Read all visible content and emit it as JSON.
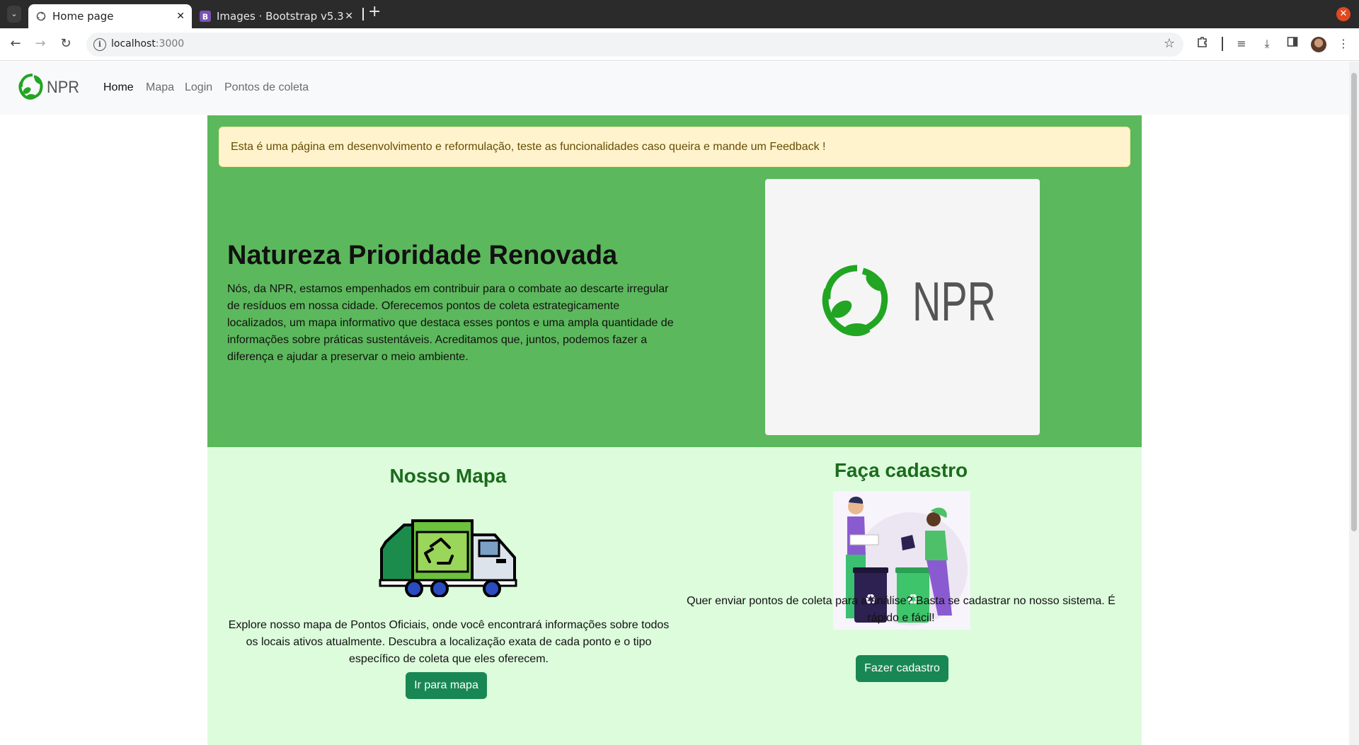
{
  "browser": {
    "tabs": [
      {
        "title": "Home page",
        "active": true,
        "favicon": "recycle-icon"
      },
      {
        "title": "Images · Bootstrap v5.3",
        "active": false,
        "favicon": "bootstrap-icon"
      }
    ],
    "url_host": "localhost",
    "url_port": ":3000"
  },
  "navbar": {
    "brand": "NPR",
    "links": [
      "Home",
      "Mapa",
      "Login",
      "Pontos de coleta"
    ],
    "active": "Home"
  },
  "hero": {
    "alert": "Esta é uma página em desenvolvimento e reformulação, teste as funcionalidades caso queira e mande um Feedback !",
    "title": "Natureza Prioridade Renovada",
    "text": "Nós, da NPR, estamos empenhados em contribuir para o combate ao descarte irregular de resíduos em nossa cidade. Oferecemos pontos de coleta estrategicamente localizados, um mapa informativo que destaca esses pontos e uma ampla quantidade de informações sobre práticas sustentáveis. Acreditamos que, juntos, podemos fazer a diferença e ajudar a preservar o meio ambiente.",
    "logo_text": "NPR"
  },
  "features": {
    "map": {
      "title": "Nosso Mapa",
      "text": "Explore nosso mapa de Pontos Oficiais, onde você encontrará informações sobre todos os locais ativos atualmente. Descubra a localização exata de cada ponto e o tipo específico de coleta que eles oferecem.",
      "button": "Ir para mapa"
    },
    "signup": {
      "title": "Faça cadastro",
      "text": "Quer enviar pontos de coleta para a análise? Basta se cadastrar no nosso sistema. É rápido e fácil!",
      "button": "Fazer cadastro"
    }
  },
  "colors": {
    "hero_bg": "#5cb85c",
    "features_bg": "#dcfcdc",
    "button": "#198754",
    "logo_green": "#22a522"
  }
}
